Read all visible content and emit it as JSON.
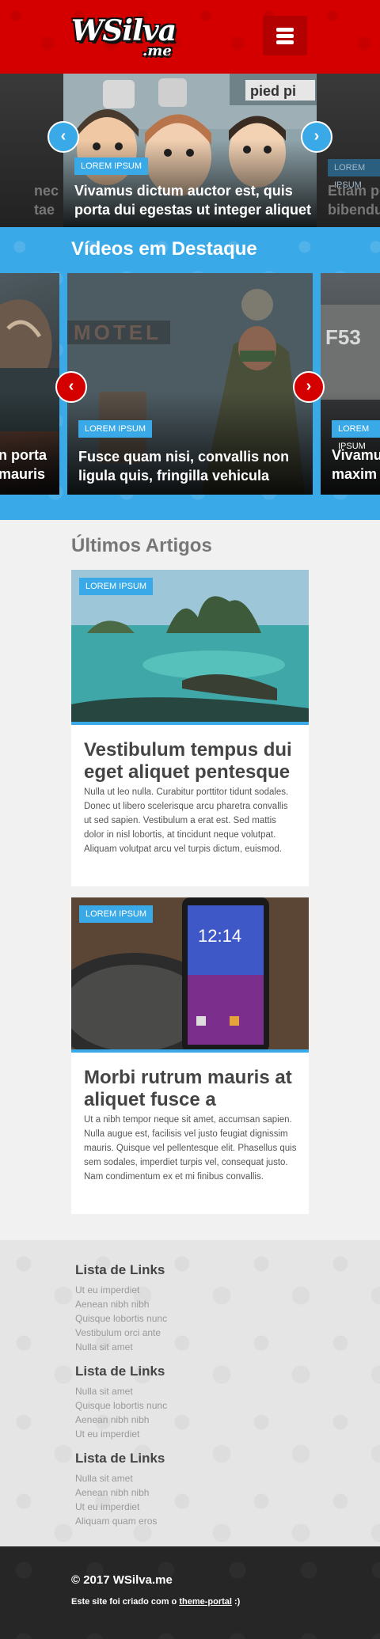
{
  "header": {
    "logo_main": "WSilva",
    "logo_sub": ".me"
  },
  "slider": {
    "left_partial_title": [
      "nec",
      "tae"
    ],
    "main": {
      "tag": "LOREM IPSUM",
      "title_line1": "Vivamus dictum auctor est, quis",
      "title_line2": "porta dui egestas ut integer aliquet"
    },
    "right_partial_tag": "LOREM IPSUM",
    "right_partial_title": [
      "Etiam pe",
      "bibendu"
    ]
  },
  "videos": {
    "section_title": "Vídeos em Destaque",
    "left_partial_title": [
      "n porta",
      "mauris"
    ],
    "main": {
      "tag": "LOREM IPSUM",
      "title_line1": "Fusce quam nisi, convallis non",
      "title_line2": "ligula quis, fringilla vehicula"
    },
    "right_partial_tag": "LOREM IPSUM",
    "right_partial_title": [
      "Vivamu",
      "maxim"
    ]
  },
  "articles": {
    "section_title": "Últimos Artigos",
    "items": [
      {
        "tag": "LOREM IPSUM",
        "title": "Vestibulum tempus dui eget aliquet pentesque",
        "text": "Nulla ut leo nulla. Curabitur porttitor tidunt sodales. Donec ut libero scelerisque arcu pharetra convallis ut sed sapien. Vestibulum a erat est. Sed mattis dolor in nisl lobortis, at tincidunt neque volutpat. Aliquam volutpat arcu vel turpis dictum, euismod."
      },
      {
        "tag": "LOREM IPSUM",
        "title": "Morbi rutrum mauris at aliquet fusce a",
        "text": "Ut a nibh tempor neque sit amet, accumsan sapien. Nulla augue est, facilisis vel justo feugiat dignissim mauris. Quisque vel pellentesque elit. Phasellus quis sem sodales, imperdiet turpis vel, consequat justo. Nam condimentum ex et mi finibus convallis."
      }
    ]
  },
  "footer_links": [
    {
      "title": "Lista de Links",
      "links": [
        "Ut eu imperdiet",
        "Aenean nibh nibh",
        "Quisque lobortis nunc",
        "Vestibulum orci ante",
        "Nulla sit amet"
      ]
    },
    {
      "title": "Lista de Links",
      "links": [
        "Nulla sit amet",
        "Quisque lobortis nunc",
        "Aenean nibh nibh",
        "Ut eu imperdiet"
      ]
    },
    {
      "title": "Lista de Links",
      "links": [
        "Nulla sit amet",
        "Aenean nibh nibh",
        "Ut eu imperdiet",
        "Aliquam quam eros"
      ]
    }
  ],
  "footer": {
    "copyright": "© 2017 WSilva.me",
    "credit_prefix": "Este site foi criado com o ",
    "credit_link": "theme-portal",
    "credit_suffix": " :)"
  },
  "icons": {
    "menu": "hamburger-icon",
    "prev": "chevron-left-icon",
    "next": "chevron-right-icon"
  },
  "colors": {
    "brand_red": "#d40000",
    "accent_blue": "#3aa9e8",
    "footer_dark": "#262626"
  }
}
